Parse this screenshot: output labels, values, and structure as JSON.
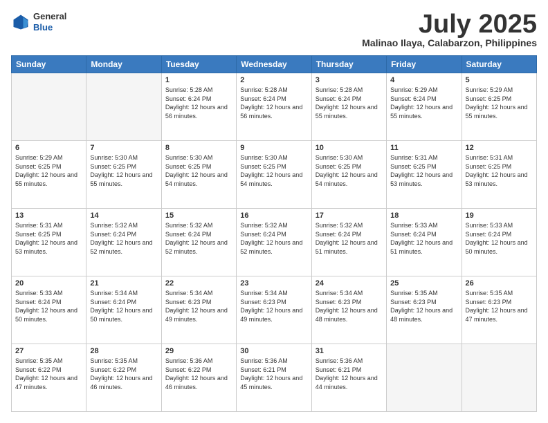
{
  "logo": {
    "general": "General",
    "blue": "Blue"
  },
  "header": {
    "month": "July 2025",
    "location": "Malinao Ilaya, Calabarzon, Philippines"
  },
  "weekdays": [
    "Sunday",
    "Monday",
    "Tuesday",
    "Wednesday",
    "Thursday",
    "Friday",
    "Saturday"
  ],
  "weeks": [
    [
      {
        "day": "",
        "info": ""
      },
      {
        "day": "",
        "info": ""
      },
      {
        "day": "1",
        "info": "Sunrise: 5:28 AM\nSunset: 6:24 PM\nDaylight: 12 hours and 56 minutes."
      },
      {
        "day": "2",
        "info": "Sunrise: 5:28 AM\nSunset: 6:24 PM\nDaylight: 12 hours and 56 minutes."
      },
      {
        "day": "3",
        "info": "Sunrise: 5:28 AM\nSunset: 6:24 PM\nDaylight: 12 hours and 55 minutes."
      },
      {
        "day": "4",
        "info": "Sunrise: 5:29 AM\nSunset: 6:24 PM\nDaylight: 12 hours and 55 minutes."
      },
      {
        "day": "5",
        "info": "Sunrise: 5:29 AM\nSunset: 6:25 PM\nDaylight: 12 hours and 55 minutes."
      }
    ],
    [
      {
        "day": "6",
        "info": "Sunrise: 5:29 AM\nSunset: 6:25 PM\nDaylight: 12 hours and 55 minutes."
      },
      {
        "day": "7",
        "info": "Sunrise: 5:30 AM\nSunset: 6:25 PM\nDaylight: 12 hours and 55 minutes."
      },
      {
        "day": "8",
        "info": "Sunrise: 5:30 AM\nSunset: 6:25 PM\nDaylight: 12 hours and 54 minutes."
      },
      {
        "day": "9",
        "info": "Sunrise: 5:30 AM\nSunset: 6:25 PM\nDaylight: 12 hours and 54 minutes."
      },
      {
        "day": "10",
        "info": "Sunrise: 5:30 AM\nSunset: 6:25 PM\nDaylight: 12 hours and 54 minutes."
      },
      {
        "day": "11",
        "info": "Sunrise: 5:31 AM\nSunset: 6:25 PM\nDaylight: 12 hours and 53 minutes."
      },
      {
        "day": "12",
        "info": "Sunrise: 5:31 AM\nSunset: 6:25 PM\nDaylight: 12 hours and 53 minutes."
      }
    ],
    [
      {
        "day": "13",
        "info": "Sunrise: 5:31 AM\nSunset: 6:25 PM\nDaylight: 12 hours and 53 minutes."
      },
      {
        "day": "14",
        "info": "Sunrise: 5:32 AM\nSunset: 6:24 PM\nDaylight: 12 hours and 52 minutes."
      },
      {
        "day": "15",
        "info": "Sunrise: 5:32 AM\nSunset: 6:24 PM\nDaylight: 12 hours and 52 minutes."
      },
      {
        "day": "16",
        "info": "Sunrise: 5:32 AM\nSunset: 6:24 PM\nDaylight: 12 hours and 52 minutes."
      },
      {
        "day": "17",
        "info": "Sunrise: 5:32 AM\nSunset: 6:24 PM\nDaylight: 12 hours and 51 minutes."
      },
      {
        "day": "18",
        "info": "Sunrise: 5:33 AM\nSunset: 6:24 PM\nDaylight: 12 hours and 51 minutes."
      },
      {
        "day": "19",
        "info": "Sunrise: 5:33 AM\nSunset: 6:24 PM\nDaylight: 12 hours and 50 minutes."
      }
    ],
    [
      {
        "day": "20",
        "info": "Sunrise: 5:33 AM\nSunset: 6:24 PM\nDaylight: 12 hours and 50 minutes."
      },
      {
        "day": "21",
        "info": "Sunrise: 5:34 AM\nSunset: 6:24 PM\nDaylight: 12 hours and 50 minutes."
      },
      {
        "day": "22",
        "info": "Sunrise: 5:34 AM\nSunset: 6:23 PM\nDaylight: 12 hours and 49 minutes."
      },
      {
        "day": "23",
        "info": "Sunrise: 5:34 AM\nSunset: 6:23 PM\nDaylight: 12 hours and 49 minutes."
      },
      {
        "day": "24",
        "info": "Sunrise: 5:34 AM\nSunset: 6:23 PM\nDaylight: 12 hours and 48 minutes."
      },
      {
        "day": "25",
        "info": "Sunrise: 5:35 AM\nSunset: 6:23 PM\nDaylight: 12 hours and 48 minutes."
      },
      {
        "day": "26",
        "info": "Sunrise: 5:35 AM\nSunset: 6:23 PM\nDaylight: 12 hours and 47 minutes."
      }
    ],
    [
      {
        "day": "27",
        "info": "Sunrise: 5:35 AM\nSunset: 6:22 PM\nDaylight: 12 hours and 47 minutes."
      },
      {
        "day": "28",
        "info": "Sunrise: 5:35 AM\nSunset: 6:22 PM\nDaylight: 12 hours and 46 minutes."
      },
      {
        "day": "29",
        "info": "Sunrise: 5:36 AM\nSunset: 6:22 PM\nDaylight: 12 hours and 46 minutes."
      },
      {
        "day": "30",
        "info": "Sunrise: 5:36 AM\nSunset: 6:21 PM\nDaylight: 12 hours and 45 minutes."
      },
      {
        "day": "31",
        "info": "Sunrise: 5:36 AM\nSunset: 6:21 PM\nDaylight: 12 hours and 44 minutes."
      },
      {
        "day": "",
        "info": ""
      },
      {
        "day": "",
        "info": ""
      }
    ]
  ]
}
